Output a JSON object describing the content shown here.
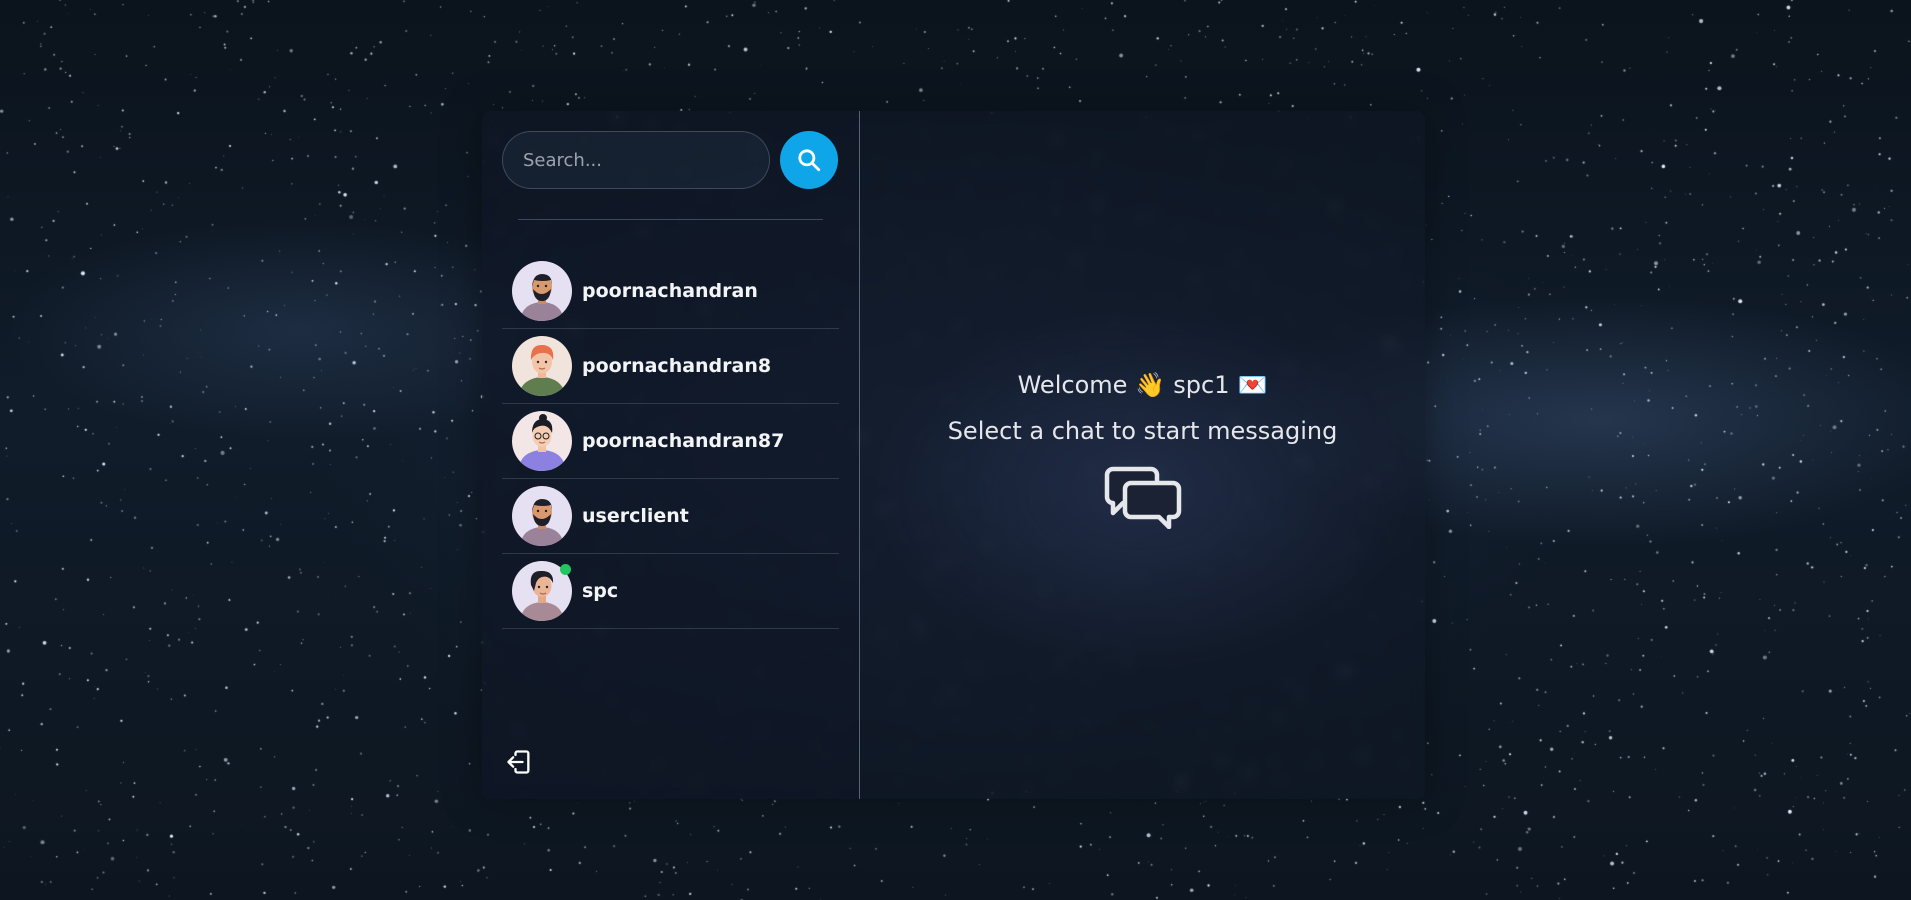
{
  "search": {
    "placeholder": "Search..."
  },
  "users": [
    {
      "name": "poornachandran",
      "avatar_icon": "avatar-bearded-man",
      "online": false
    },
    {
      "name": "poornachandran8",
      "avatar_icon": "avatar-redhead-man",
      "online": false
    },
    {
      "name": "poornachandran87",
      "avatar_icon": "avatar-glasses-man",
      "online": false
    },
    {
      "name": "userclient",
      "avatar_icon": "avatar-bearded-man",
      "online": false
    },
    {
      "name": "spc",
      "avatar_icon": "avatar-dark-hair-man",
      "online": true
    }
  ],
  "welcome": {
    "prefix": "Welcome",
    "wave_emoji": "👋",
    "username": "spc1",
    "heart_emoji": "💌",
    "subtitle": "Select a chat to start messaging"
  },
  "icons": {
    "search": "search-icon",
    "logout": "logout-icon",
    "chat": "chat-bubbles-icon"
  },
  "colors": {
    "accent": "#0ea5e9",
    "online": "#22c55e",
    "panel": "#111827"
  }
}
